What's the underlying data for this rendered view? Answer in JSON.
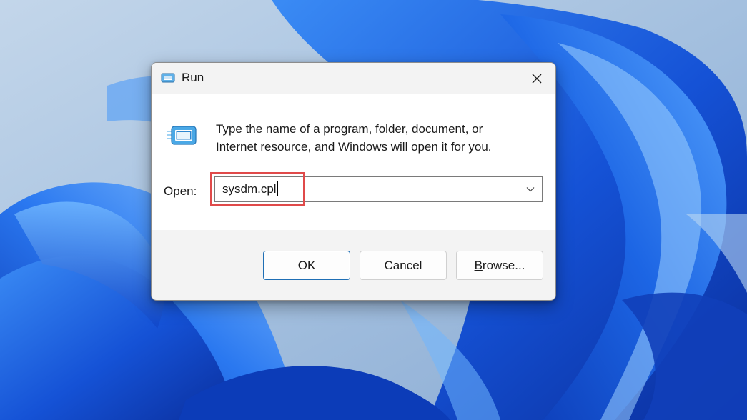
{
  "dialog": {
    "title": "Run",
    "close_icon": "close-icon",
    "app_icon": "run-icon",
    "description_line1": "Type the name of a program, folder, document, or",
    "description_line2": "Internet resource, and Windows will open it for you.",
    "open_label_access_key": "O",
    "open_label_rest": "pen:",
    "input_value": "sysdm.cpl",
    "dropdown_icon": "chevron-down-icon",
    "highlight_color": "#e04a4a"
  },
  "buttons": {
    "ok": "OK",
    "cancel": "Cancel",
    "browse_access_key": "B",
    "browse_rest": "rowse..."
  },
  "colors": {
    "dialog_bg": "#f3f3f3",
    "content_bg": "#ffffff",
    "default_button_border": "#1f6fb5",
    "wallpaper_primary": "#1f5fd6",
    "wallpaper_background": "#a9c6e2"
  }
}
